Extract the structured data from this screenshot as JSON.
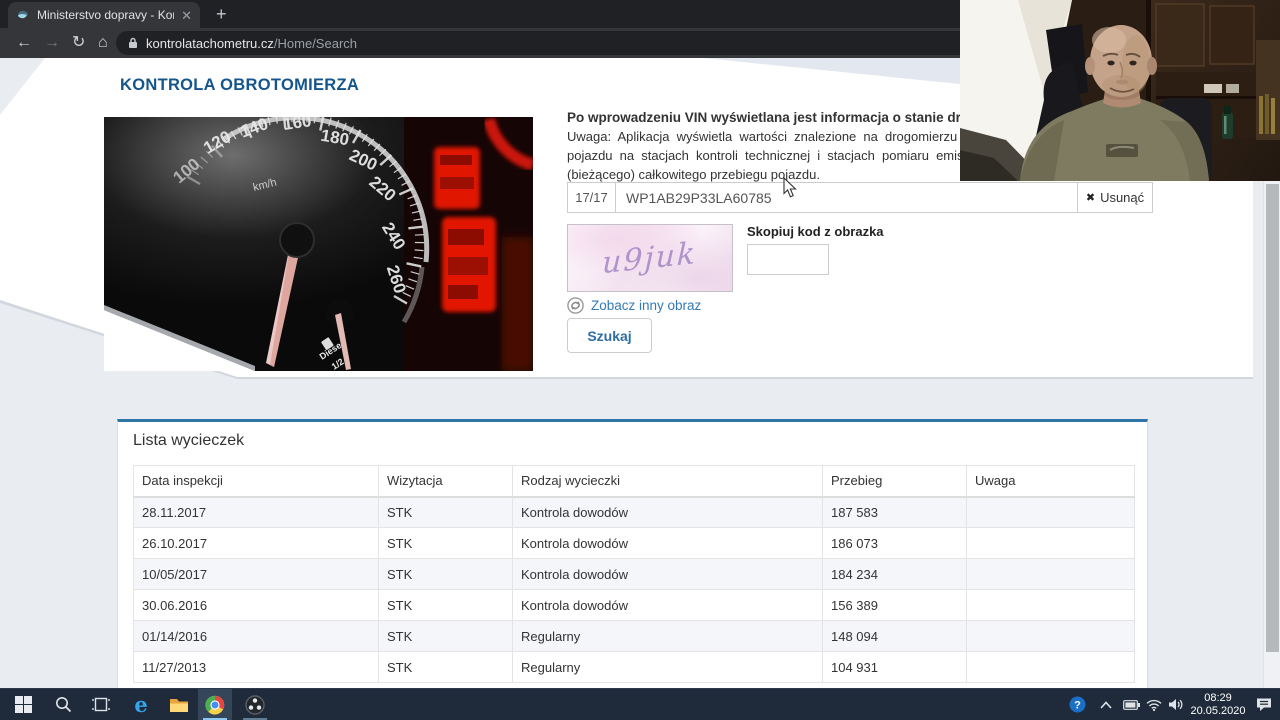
{
  "browser": {
    "tab_title": "Ministerstvo dopravy - Kontrola t",
    "tab_close": "✕",
    "new_tab": "+",
    "url_domain": "kontrolatachometru.cz",
    "url_path": "/Home/Search"
  },
  "page": {
    "title": "KONTROLA OBROTOMIERZA",
    "intro_lines": [
      "Po wprowadzeniu VIN wyświetlana jest informacja o stanie drogomierza",
      "Uwaga: Aplikacja wyświetla wartości znalezione na drogomierzu pojazdu",
      "pojazdu na stacjach kontroli technicznej i stacjach pomiaru emisji i m",
      "(bieżącego) całkowitego przebiegu pojazdu."
    ],
    "vin": {
      "counter": "17/17",
      "value": "WP1AB29P33LA60785",
      "remove_icon": "✖",
      "remove_label": "Usunąć"
    },
    "captcha": {
      "text": "u9juk",
      "copy_label": "Skopiuj kod z obrazka",
      "code_value": "",
      "refresh_label": "Zobacz inny obraz",
      "search_label": "Szukaj"
    },
    "gauge": {
      "numbers": [
        "100",
        "120",
        "140",
        "160",
        "180",
        "200",
        "220",
        "240",
        "260"
      ],
      "unit": "km/h",
      "fuel_label": "Diese",
      "fuel_level": "1/2"
    },
    "table": {
      "title": "Lista wycieczek",
      "columns": [
        "Data inspekcji",
        "Wizytacja",
        "Rodzaj wycieczki",
        "Przebieg",
        "Uwaga"
      ],
      "rows": [
        [
          "28.11.2017",
          "STK",
          "Kontrola dowodów",
          "187 583",
          ""
        ],
        [
          "26.10.2017",
          "STK",
          "Kontrola dowodów",
          "186 073",
          ""
        ],
        [
          "10/05/2017",
          "STK",
          "Kontrola dowodów",
          "184 234",
          ""
        ],
        [
          "30.06.2016",
          "STK",
          "Kontrola dowodów",
          "156 389",
          ""
        ],
        [
          "01/14/2016",
          "STK",
          "Regularny",
          "148 094",
          ""
        ],
        [
          "11/27/2013",
          "STK",
          "Regularny",
          "104 931",
          ""
        ]
      ]
    }
  },
  "taskbar": {
    "time": "08:29",
    "date": "20.05.2020"
  },
  "colors": {
    "accent_blue": "#2f76a8",
    "heading_blue": "#15558d",
    "link_blue": "#337ab7",
    "stripe_row": "#f4f6f9",
    "taskbar_bg": "#1f2b3b"
  }
}
